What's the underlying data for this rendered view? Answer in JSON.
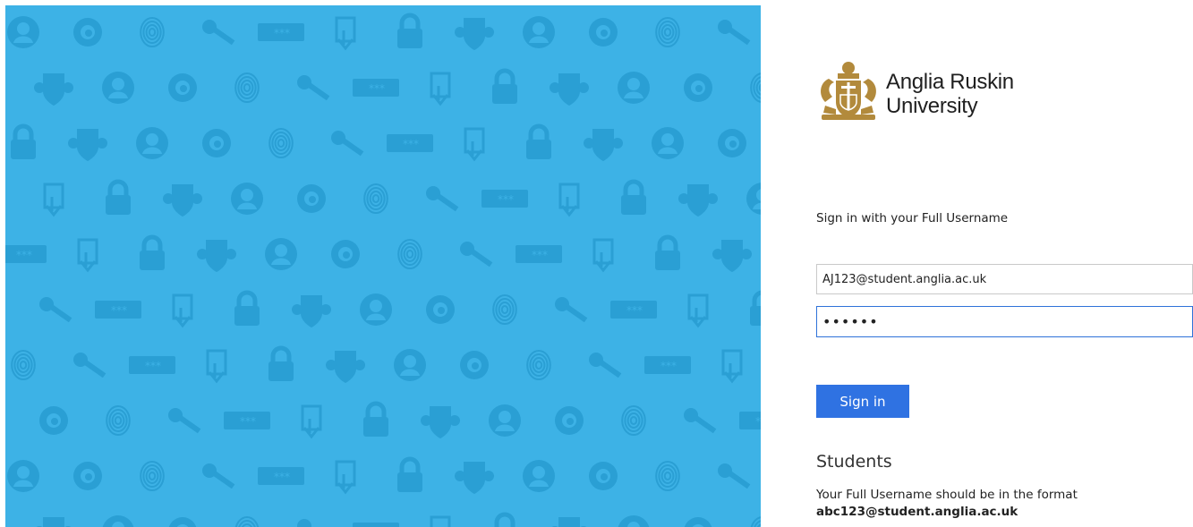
{
  "brand": {
    "line1": "Anglia Ruskin",
    "line2": "University",
    "gold": "#b28a3c"
  },
  "hero": {
    "background": "#3db2e6",
    "pattern_icons": [
      "person-icon",
      "key-icon",
      "lock-icon",
      "eye-icon",
      "password-field-icon",
      "crest-icon",
      "fingerprint-icon",
      "touch-icon"
    ]
  },
  "form": {
    "prompt": "Sign in with your Full Username",
    "username_value": "AJ123@student.anglia.ac.uk",
    "password_value": "••••••",
    "sign_in_label": "Sign in"
  },
  "help": {
    "heading": "Students",
    "text": "Your Full Username should be in the format",
    "example": "abc123@student.anglia.ac.uk"
  }
}
